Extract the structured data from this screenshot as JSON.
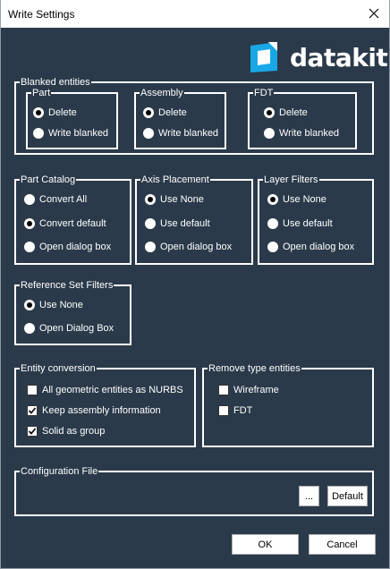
{
  "window": {
    "title": "Write Settings"
  },
  "logo": {
    "text": "datakit",
    "accent": "#19a8e6"
  },
  "blanked": {
    "label": "Blanked entities",
    "part": {
      "label": "Part",
      "options": [
        "Delete",
        "Write blanked"
      ],
      "selected": 0
    },
    "assembly": {
      "label": "Assembly",
      "options": [
        "Delete",
        "Write blanked"
      ],
      "selected": 0
    },
    "fdt": {
      "label": "FDT",
      "options": [
        "Delete",
        "Write blanked"
      ],
      "selected": 0
    }
  },
  "part_catalog": {
    "label": "Part Catalog",
    "options": [
      "Convert All",
      "Convert default",
      "Open dialog box"
    ],
    "selected": 1
  },
  "axis_placement": {
    "label": "Axis Placement",
    "options": [
      "Use None",
      "Use default",
      "Open dialog box"
    ],
    "selected": 0
  },
  "layer_filters": {
    "label": "Layer Filters",
    "options": [
      "Use None",
      "Use default",
      "Open dialog box"
    ],
    "selected": 0
  },
  "reference_set": {
    "label": "Reference Set Filters",
    "options": [
      "Use None",
      "Open Dialog Box"
    ],
    "selected": 0
  },
  "entity_conversion": {
    "label": "Entity conversion",
    "items": [
      {
        "label": "All geometric entities as NURBS",
        "checked": false
      },
      {
        "label": "Keep assembly information",
        "checked": true
      },
      {
        "label": "Solid as group",
        "checked": true
      }
    ]
  },
  "remove_type": {
    "label": "Remove type entities",
    "items": [
      {
        "label": "Wireframe",
        "checked": false
      },
      {
        "label": "FDT",
        "checked": false
      }
    ]
  },
  "config_file": {
    "label": "Configuration File",
    "browse_label": "...",
    "default_label": "Default"
  },
  "buttons": {
    "ok": "OK",
    "cancel": "Cancel"
  },
  "colors": {
    "background": "#2b3a4a",
    "foreground": "#ffffff"
  }
}
